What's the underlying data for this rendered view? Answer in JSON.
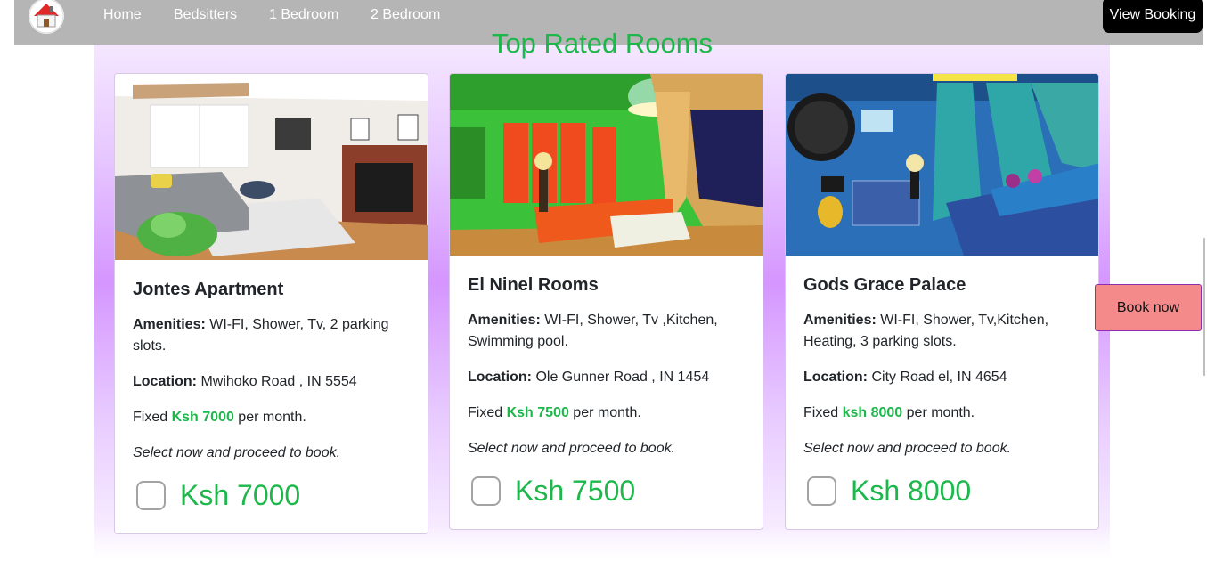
{
  "nav": {
    "links": [
      "Home",
      "Bedsitters",
      "1 Bedroom",
      "2 Bedroom"
    ],
    "view_booking": "View Booking"
  },
  "section_title": "Top Rated Rooms",
  "amenities_label": "Amenities:",
  "location_label": "Location:",
  "rooms": [
    {
      "title": "Jontes Apartment",
      "amenities": "WI-FI, Shower, Tv, 2 parking slots.",
      "location": "Mwihoko Road , IN 5554",
      "fixed_prefix": "Fixed",
      "fixed_price": "Ksh 7000",
      "fixed_suffix": "per month.",
      "note": "Select now and proceed to book.",
      "price": "Ksh 7000"
    },
    {
      "title": "El Ninel Rooms",
      "amenities": "WI-FI, Shower, Tv ,Kitchen, Swimming pool.",
      "location": "Ole Gunner Road , IN 1454",
      "fixed_prefix": "Fixed",
      "fixed_price": "Ksh 7500",
      "fixed_suffix": "per month.",
      "note": "Select now and proceed to book.",
      "price": "Ksh 7500"
    },
    {
      "title": "Gods Grace Palace",
      "amenities": "WI-FI, Shower, Tv,Kitchen, Heating, 3 parking slots.",
      "location": "City Road el, IN 4654",
      "fixed_prefix": "Fixed",
      "fixed_price": "ksh 8000",
      "fixed_suffix": "per month.",
      "note": "Select now and proceed to book.",
      "price": "Ksh 8000"
    }
  ],
  "book_now": "Book now",
  "icons": {
    "logo": "house-icon",
    "checkbox": "checkbox-unchecked-icon"
  },
  "colors": {
    "accent_green": "#1db74b",
    "navbar": "#b5b5b5",
    "book_now": "#f48a8a"
  }
}
